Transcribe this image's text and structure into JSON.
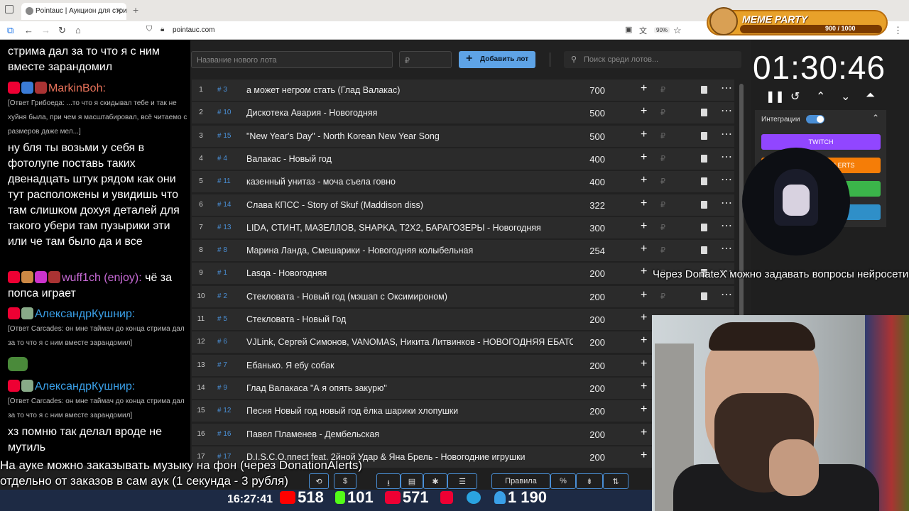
{
  "browser": {
    "tab_title": "Pointauc | Аукцион для стрима",
    "url": "pointauc.com",
    "zoom": "90%"
  },
  "meme_party": {
    "title": "MEME PARTY",
    "count": "900 / 1000"
  },
  "chat": {
    "lines": [
      {
        "text": "стрима дал за то что я с ним вместе зарандомил",
        "kind": "msg"
      },
      {
        "text": "MarkinBoh:",
        "kind": "user",
        "color": "#e8725a"
      },
      {
        "text": "[Ответ Грибоеда: ...то что я скидывал тебе и так не хуйня была, при чем я масштабировал, всё читаемо с размеров даже мел...]",
        "kind": "reply"
      },
      {
        "text": "ну бля ты возьми у себя в фотолупе поставь таких двенадцать штук рядом как они тут расположены и увидишь что там слишком дохуя деталей для такого убери там пузырики эти или че там было да и все",
        "kind": "msg"
      },
      {
        "text": "wuff1ch (enjoy):",
        "kind": "user",
        "color": "#c86ad6"
      },
      {
        "text": "чё за попса играет",
        "kind": "msg"
      },
      {
        "text": "АлександрКушнир:",
        "kind": "user",
        "color": "#3aa0e8"
      },
      {
        "text": "[Ответ Carcades: он мне таймач до конца стрима дал за то что я с ним вместе зарандомил]",
        "kind": "reply"
      },
      {
        "text": "АлександрКушнир:",
        "kind": "user",
        "color": "#3aa0e8"
      },
      {
        "text": "[Ответ Carcades: он мне таймач до конца стрима дал за то что я с ним вместе зарандомил]",
        "kind": "reply"
      },
      {
        "text": "хз помню так делал вроде не мутиль",
        "kind": "msg"
      }
    ]
  },
  "toolbar": {
    "new_lot_placeholder": "Название нового лота",
    "amount_placeholder": "₽",
    "add_label": "Добавить лот",
    "search_placeholder": "Поиск среди лотов..."
  },
  "lots": [
    {
      "n": "1",
      "id": "# 3",
      "name": "а может негром стать (Глад Валакас)",
      "amount": "700"
    },
    {
      "n": "2",
      "id": "# 10",
      "name": "Дискотека Авария - Новогодняя",
      "amount": "500"
    },
    {
      "n": "3",
      "id": "# 15",
      "name": "\"New Year's Day\" - North Korean New Year Song",
      "amount": "500"
    },
    {
      "n": "4",
      "id": "# 4",
      "name": "Валакас - Новый год",
      "amount": "400"
    },
    {
      "n": "5",
      "id": "# 11",
      "name": "казенный унитаз - моча съела говно",
      "amount": "400"
    },
    {
      "n": "6",
      "id": "# 14",
      "name": "Слава КПСС - Story of Skuf (Maddison diss)",
      "amount": "322"
    },
    {
      "n": "7",
      "id": "# 13",
      "name": "LIDA, СТИНТ, МАЗЕЛЛОВ, SHAPKA, T2X2, БАРАГОЗЕРЫ - Новогодняя",
      "amount": "300"
    },
    {
      "n": "8",
      "id": "# 8",
      "name": "Марина Ланда, Смешарики - Новогодняя колыбельная",
      "amount": "254"
    },
    {
      "n": "9",
      "id": "# 1",
      "name": "Lasqa - Новогодняя",
      "amount": "200"
    },
    {
      "n": "10",
      "id": "# 2",
      "name": "Стекловата - Новый год (мэшап с Оксимироном)",
      "amount": "200"
    },
    {
      "n": "11",
      "id": "# 5",
      "name": "Стекловата - Новый Год",
      "amount": "200"
    },
    {
      "n": "12",
      "id": "# 6",
      "name": "VJLink, Сергей Симонов, VANOMAS, Никита Литвинков - НОВОГОДНЯЯ ЕБАТО",
      "amount": "200"
    },
    {
      "n": "13",
      "id": "# 7",
      "name": "Ебанько. Я ебу собак",
      "amount": "200"
    },
    {
      "n": "14",
      "id": "# 9",
      "name": "Глад Валакаса \"А я опять закурю\"",
      "amount": "200"
    },
    {
      "n": "15",
      "id": "# 12",
      "name": "Песня Новый год новый год ёлка шарики хлопушки",
      "amount": "200"
    },
    {
      "n": "16",
      "id": "# 16",
      "name": "Павел Пламенев - Дембельская",
      "amount": "200"
    },
    {
      "n": "17",
      "id": "# 17",
      "name": "D.I.S.C.O.nnect feat. 2йной Удар & Яна Брель - Новогодние игрушки",
      "amount": "200"
    }
  ],
  "bottom_toolbar": {
    "rules_label": "Правила",
    "percent_label": "%"
  },
  "timer": {
    "value": "01:30:46"
  },
  "integrations": {
    "label": "Интеграции",
    "twitch": "TWITCH",
    "alerts": "ALERTS"
  },
  "overlay": {
    "caption": "Через DonateX можно задавать вопросы нейросети",
    "notice_line1": "На ауке можно заказывать музыку на фон (через DonationAlerts)",
    "notice_line2": "отдельно от заказов в сам аук (1 секунда - 3 рубля)"
  },
  "stats": {
    "time": "16:27:41",
    "youtube": "518",
    "kick": "101",
    "vk": "571",
    "viewers": "1 190"
  },
  "colors": {
    "accent": "#5ea3e6",
    "twitch": "#9146ff",
    "alerts": "#f57d07",
    "green": "#3bb54a",
    "blue": "#2f8fc8"
  }
}
